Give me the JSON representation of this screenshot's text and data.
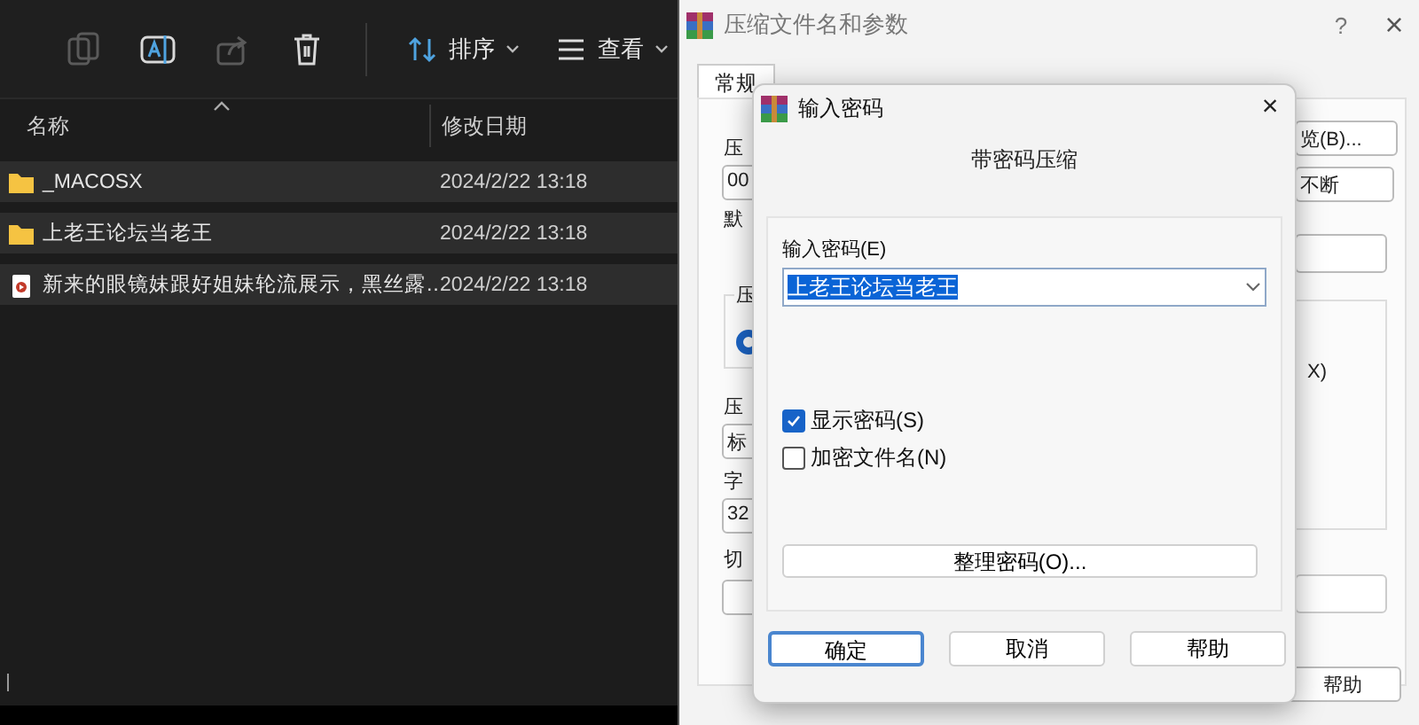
{
  "explorer": {
    "toolbar": [
      {
        "kind": "copy",
        "disabled": true
      },
      {
        "kind": "rename",
        "disabled": false
      },
      {
        "kind": "share",
        "disabled": true
      },
      {
        "kind": "delete",
        "disabled": false
      }
    ],
    "sort": "排序",
    "view": "查看",
    "columns": [
      "名称",
      "修改日期"
    ],
    "rows": [
      {
        "kind": "folder",
        "name": "_MACOSX",
        "date": "2024/2/22 13:18",
        "selected": true
      },
      {
        "kind": "folder",
        "name": "上老王论坛当老王",
        "date": "2024/2/22 13:18",
        "selected": true
      },
      {
        "kind": "video",
        "name": "新来的眼镜妹跟好姐妹轮流展示，黑丝露…",
        "date": "2024/2/22 13:18",
        "selected": true
      }
    ]
  },
  "archive_dialog": {
    "title": "压缩文件名和参数",
    "help": "?",
    "close": "×",
    "tabs": [
      {
        "label": "常规",
        "selected": true
      }
    ],
    "radio": {
      "selected": true
    },
    "fragments": [
      {
        "kind": "label",
        "text": "压"
      },
      {
        "kind": "field",
        "text": "00"
      },
      {
        "kind": "label",
        "text": "默"
      },
      {
        "kind": "label",
        "text": "压"
      },
      {
        "kind": "label",
        "text": "压"
      },
      {
        "kind": "field",
        "text": "标"
      },
      {
        "kind": "label",
        "text": "字"
      },
      {
        "kind": "field",
        "text": "32"
      },
      {
        "kind": "label",
        "text": "切"
      },
      {
        "kind": "button",
        "text": "览(B)..."
      },
      {
        "kind": "combo",
        "text": "不断"
      },
      {
        "kind": "label",
        "text": "X)"
      },
      {
        "kind": "button",
        "text": "帮助"
      }
    ]
  },
  "password_dialog": {
    "title": "输入密码",
    "close": "×",
    "heading": "带密码压缩",
    "field_label": "输入密码(E)",
    "password": "上老王论坛当老王",
    "checkboxes": [
      {
        "label": "显示密码(S)",
        "checked": true
      },
      {
        "label": "加密文件名(N)",
        "checked": false
      }
    ],
    "organize_button": "整理密码(O)...",
    "buttons": [
      {
        "label": "确定",
        "default": true
      },
      {
        "label": "取消",
        "default": false
      },
      {
        "label": "帮助",
        "default": false
      }
    ]
  }
}
